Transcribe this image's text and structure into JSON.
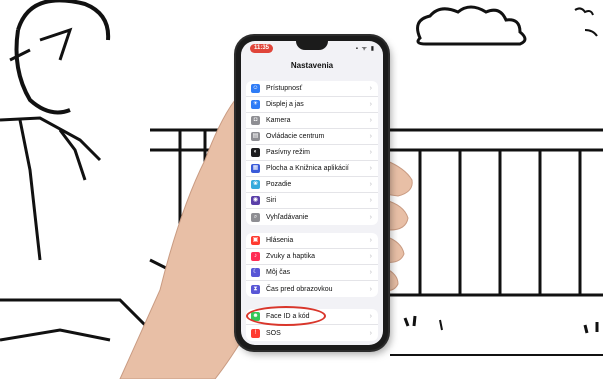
{
  "status": {
    "time": "11:35",
    "icons": "▪ ᯤ ▮"
  },
  "nav": {
    "title": "Nastavenia"
  },
  "groups": [
    {
      "items": [
        {
          "label": "Prístupnosť",
          "icon": "accessibility-icon",
          "color": "#2f7cf6",
          "glyph": "☺"
        },
        {
          "label": "Displej a jas",
          "icon": "brightness-icon",
          "color": "#2f7cf6",
          "glyph": "☀"
        },
        {
          "label": "Kamera",
          "icon": "camera-icon",
          "color": "#8e8e93",
          "glyph": "◘"
        },
        {
          "label": "Ovládacie centrum",
          "icon": "control-center-icon",
          "color": "#8e8e93",
          "glyph": "▤"
        },
        {
          "label": "Pasívny režim",
          "icon": "standby-icon",
          "color": "#1c1c1e",
          "glyph": "◐"
        },
        {
          "label": "Plocha a Knižnica aplikácií",
          "icon": "home-screen-icon",
          "color": "#3a5bd9",
          "glyph": "▦"
        },
        {
          "label": "Pozadie",
          "icon": "wallpaper-icon",
          "color": "#34aadc",
          "glyph": "❀"
        },
        {
          "label": "Siri",
          "icon": "siri-icon",
          "color": "#5a3fa8",
          "glyph": "◉"
        },
        {
          "label": "Vyhľadávanie",
          "icon": "search-icon",
          "color": "#8e8e93",
          "glyph": "⌕"
        }
      ]
    },
    {
      "items": [
        {
          "label": "Hlásenia",
          "icon": "notifications-icon",
          "color": "#ff3b30",
          "glyph": "▣"
        },
        {
          "label": "Zvuky a haptika",
          "icon": "sounds-icon",
          "color": "#ff2d55",
          "glyph": "♪"
        },
        {
          "label": "Môj čas",
          "icon": "focus-icon",
          "color": "#5856d6",
          "glyph": "☾"
        },
        {
          "label": "Čas pred obrazovkou",
          "icon": "screen-time-icon",
          "color": "#5856d6",
          "glyph": "⧗"
        }
      ]
    },
    {
      "items": [
        {
          "label": "Face ID a kód",
          "icon": "face-id-icon",
          "color": "#34c759",
          "glyph": "☻"
        },
        {
          "label": "SOS",
          "icon": "sos-icon",
          "color": "#ff3b30",
          "glyph": "!"
        }
      ]
    }
  ]
}
